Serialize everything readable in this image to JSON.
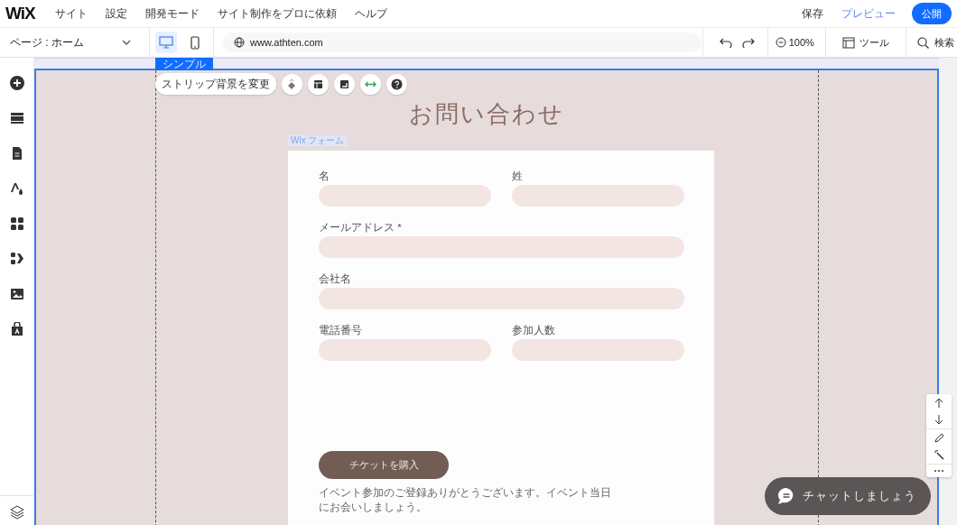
{
  "topbar": {
    "logo": "WiX",
    "menu": [
      "サイト",
      "設定",
      "開発モード",
      "サイト制作をプロに依頼",
      "ヘルプ"
    ],
    "save": "保存",
    "preview": "プレビュー",
    "publish": "公開"
  },
  "toolbar": {
    "page": "ページ : ホーム",
    "devices": [
      {
        "kind": "desktop",
        "selected": true
      },
      {
        "kind": "mobile",
        "selected": false
      }
    ],
    "url": "www.athten.com",
    "zoom": "100%",
    "tools": "ツール",
    "search": "検索"
  },
  "canvas": {
    "section_tag": "シンプル",
    "strip_button": "ストリップ背景を変更",
    "heading": "お問い合わせ",
    "form_tag": "Wix フォーム",
    "fields": [
      {
        "label": "名",
        "kind": "half"
      },
      {
        "label": "姓",
        "kind": "half"
      },
      {
        "label": "メールアドレス *",
        "kind": "full"
      },
      {
        "label": "会社名",
        "kind": "full"
      },
      {
        "label": "電話番号",
        "kind": "half"
      },
      {
        "label": "参加人数",
        "kind": "half"
      }
    ],
    "submit": "チケットを購入",
    "message": "イベント参加のご登録ありがとうございます。イベント当日にお会いしましょう。",
    "chat": "チャットしましょう"
  }
}
